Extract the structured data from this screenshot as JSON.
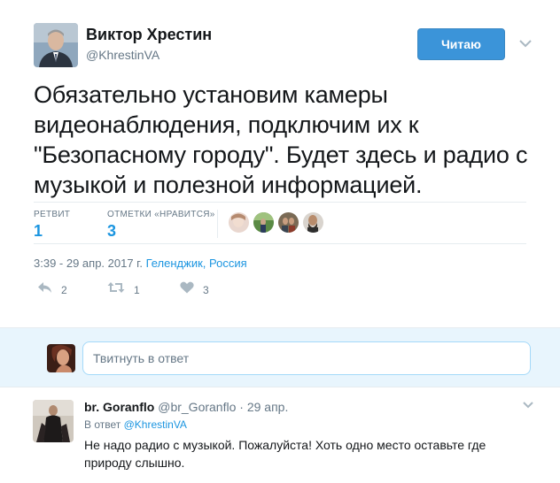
{
  "tweet": {
    "author_name": "Виктор Хрестин",
    "author_handle": "@KhrestinVA",
    "follow_label": "Читаю",
    "text": "Обязательно установим камеры видеонаблюдения, подключим их к \"Безопасному городу\". Будет здесь и радио с музыкой и полезной информацией.",
    "stats": {
      "retweets_label": "РЕТВИТ",
      "retweets_value": "1",
      "likes_label": "ОТМЕТКИ «НРАВИТСЯ»",
      "likes_value": "3"
    },
    "timestamp": "3:39 - 29 апр. 2017 г.",
    "location": "Геленджик, Россия",
    "actions": {
      "reply_count": "2",
      "retweet_count": "1",
      "like_count": "3"
    }
  },
  "reply_box": {
    "placeholder": "Твитнуть в ответ"
  },
  "reply": {
    "name": "br. Goranflo",
    "handle": "@br_Goranflo",
    "separator": "·",
    "time": "29 апр.",
    "in_reply_prefix": "В ответ",
    "in_reply_handle": "@KhrestinVA",
    "text": "Не надо радио с музыкой. Пожалуйста! Хоть одно место оставьте где природу слышно."
  },
  "icons": {
    "reply": "reply-icon",
    "retweet": "retweet-icon",
    "like": "heart-icon",
    "more": "chevron-down-icon"
  },
  "colors": {
    "accent": "#1b95e0",
    "follow_button": "#3b94d9",
    "reply_box_bg": "#e8f5fd",
    "muted": "#657786"
  }
}
